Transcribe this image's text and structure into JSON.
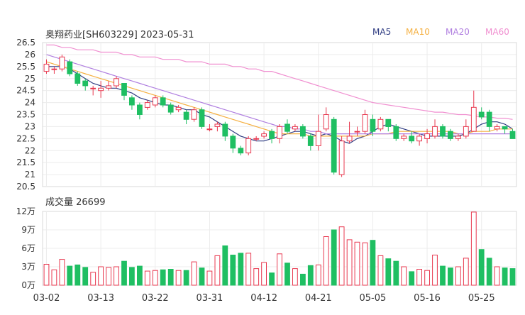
{
  "header": {
    "title": "奥翔药业[SH603229] 2023-05-31"
  },
  "legend": [
    {
      "label": "MA5",
      "color": "#2f3c82"
    },
    {
      "label": "MA10",
      "color": "#f5b041"
    },
    {
      "label": "MA20",
      "color": "#b07fe0"
    },
    {
      "label": "MA60",
      "color": "#f08fd0"
    }
  ],
  "volume_header": {
    "label": "成交量 26699"
  },
  "colors": {
    "up": "#e8384f",
    "down": "#1fbf62"
  },
  "chart_data": [
    {
      "type": "candlestick",
      "title": "奥翔药业[SH603229] 2023-05-31",
      "ylim": [
        20.5,
        26.5
      ],
      "y_ticks": [
        "26.5",
        "26",
        "25.5",
        "25",
        "24.5",
        "24",
        "23.5",
        "23",
        "22.5",
        "22",
        "21.5",
        "21",
        "20.5"
      ],
      "x_ticks": [
        "03-02",
        "03-13",
        "03-22",
        "03-31",
        "04-12",
        "04-21",
        "05-05",
        "05-16",
        "05-25"
      ],
      "x_tick_index": [
        0,
        7,
        14,
        21,
        28,
        35,
        42,
        49,
        56
      ],
      "candles": [
        [
          25.3,
          25.6,
          25.8,
          25.2
        ],
        [
          25.4,
          25.4,
          25.5,
          25.2
        ],
        [
          25.4,
          25.9,
          26.0,
          25.3
        ],
        [
          25.7,
          25.2,
          25.8,
          25.1
        ],
        [
          25.2,
          24.8,
          25.3,
          24.7
        ],
        [
          24.9,
          24.7,
          25.0,
          24.5
        ],
        [
          24.6,
          24.6,
          24.7,
          24.3
        ],
        [
          24.5,
          24.6,
          24.9,
          24.2
        ],
        [
          24.6,
          24.7,
          24.9,
          24.5
        ],
        [
          24.7,
          25.0,
          25.1,
          24.6
        ],
        [
          24.8,
          24.3,
          24.8,
          24.1
        ],
        [
          24.2,
          23.9,
          24.3,
          23.7
        ],
        [
          23.9,
          23.5,
          24.0,
          23.3
        ],
        [
          23.8,
          24.0,
          24.1,
          23.7
        ],
        [
          23.9,
          24.2,
          24.3,
          23.8
        ],
        [
          24.2,
          23.9,
          24.3,
          23.8
        ],
        [
          23.9,
          23.6,
          24.0,
          23.5
        ],
        [
          23.7,
          23.8,
          23.9,
          23.6
        ],
        [
          23.6,
          23.3,
          23.7,
          23.1
        ],
        [
          23.3,
          23.7,
          23.8,
          23.2
        ],
        [
          23.7,
          23.0,
          23.8,
          22.9
        ],
        [
          22.9,
          22.9,
          23.1,
          22.8
        ],
        [
          23.0,
          23.1,
          23.2,
          22.8
        ],
        [
          23.1,
          22.6,
          23.2,
          22.4
        ],
        [
          22.6,
          22.1,
          22.7,
          21.9
        ],
        [
          22.1,
          21.9,
          22.2,
          21.8
        ],
        [
          21.9,
          22.5,
          22.6,
          21.8
        ],
        [
          22.5,
          22.5,
          22.6,
          22.4
        ],
        [
          22.6,
          22.7,
          22.8,
          22.5
        ],
        [
          22.8,
          22.5,
          22.9,
          22.3
        ],
        [
          22.5,
          23.0,
          23.1,
          22.3
        ],
        [
          23.1,
          22.8,
          23.3,
          22.7
        ],
        [
          22.9,
          23.0,
          23.1,
          22.8
        ],
        [
          23.0,
          22.6,
          23.1,
          22.5
        ],
        [
          22.6,
          22.2,
          22.7,
          22.0
        ],
        [
          22.2,
          22.8,
          23.5,
          22.0
        ],
        [
          22.9,
          23.5,
          23.8,
          22.8
        ],
        [
          23.3,
          21.1,
          23.4,
          21.0
        ],
        [
          21.0,
          22.4,
          22.6,
          20.9
        ],
        [
          22.4,
          22.6,
          23.2,
          22.3
        ],
        [
          22.8,
          22.8,
          23.0,
          22.6
        ],
        [
          22.8,
          23.5,
          23.7,
          22.7
        ],
        [
          23.3,
          22.8,
          23.5,
          22.6
        ],
        [
          22.9,
          23.3,
          23.4,
          22.8
        ],
        [
          23.3,
          23.0,
          23.3,
          22.8
        ],
        [
          23.0,
          22.5,
          23.1,
          22.4
        ],
        [
          22.5,
          22.6,
          22.7,
          22.4
        ],
        [
          22.6,
          22.4,
          22.8,
          22.3
        ],
        [
          22.4,
          22.6,
          22.7,
          22.2
        ],
        [
          22.5,
          22.7,
          22.9,
          22.3
        ],
        [
          22.6,
          23.0,
          23.3,
          22.5
        ],
        [
          23.0,
          22.6,
          23.1,
          22.5
        ],
        [
          22.8,
          22.5,
          22.9,
          22.4
        ],
        [
          22.5,
          22.6,
          22.7,
          22.4
        ],
        [
          22.6,
          23.0,
          23.3,
          22.5
        ],
        [
          22.8,
          23.8,
          24.5,
          22.8
        ],
        [
          23.6,
          23.4,
          23.8,
          23.3
        ],
        [
          23.6,
          23.0,
          23.7,
          22.8
        ],
        [
          22.9,
          23.0,
          23.1,
          22.8
        ],
        [
          23.0,
          22.9,
          23.0,
          22.7
        ],
        [
          22.8,
          22.5,
          22.9,
          22.5
        ]
      ],
      "ma": {
        "MA5": [
          25.5,
          25.5,
          25.5,
          25.4,
          25.2,
          25.0,
          24.8,
          24.7,
          24.6,
          24.6,
          24.5,
          24.4,
          24.2,
          24.1,
          24.0,
          23.9,
          23.9,
          23.8,
          23.7,
          23.7,
          23.5,
          23.4,
          23.2,
          23.0,
          22.8,
          22.6,
          22.5,
          22.4,
          22.4,
          22.5,
          22.6,
          22.7,
          22.8,
          22.8,
          22.7,
          22.6,
          22.7,
          22.6,
          22.4,
          22.3,
          22.5,
          22.6,
          22.8,
          23.0,
          23.1,
          23.0,
          22.9,
          22.8,
          22.7,
          22.6,
          22.6,
          22.6,
          22.6,
          22.6,
          22.7,
          22.9,
          23.1,
          23.2,
          23.2,
          23.1,
          22.9
        ],
        "MA10": [
          25.7,
          25.6,
          25.5,
          25.4,
          25.3,
          25.2,
          25.1,
          25.0,
          24.9,
          24.8,
          24.7,
          24.6,
          24.5,
          24.4,
          24.3,
          24.2,
          24.1,
          24.0,
          23.9,
          23.8,
          23.7,
          23.6,
          23.5,
          23.4,
          23.3,
          23.2,
          23.1,
          23.0,
          22.9,
          22.8,
          22.7,
          22.7,
          22.7,
          22.7,
          22.6,
          22.6,
          22.6,
          22.6,
          22.6,
          22.6,
          22.6,
          22.6,
          22.7,
          22.7,
          22.7,
          22.8,
          22.8,
          22.8,
          22.8,
          22.8,
          22.8,
          22.8,
          22.8,
          22.7,
          22.7,
          22.8,
          22.8,
          22.8,
          22.9,
          22.9,
          22.9
        ],
        "MA20": [
          26.0,
          25.9,
          25.8,
          25.7,
          25.6,
          25.5,
          25.4,
          25.3,
          25.2,
          25.1,
          25.0,
          24.9,
          24.8,
          24.7,
          24.6,
          24.5,
          24.4,
          24.3,
          24.2,
          24.1,
          24.0,
          23.9,
          23.8,
          23.7,
          23.6,
          23.5,
          23.4,
          23.3,
          23.2,
          23.1,
          23.0,
          23.0,
          22.9,
          22.9,
          22.8,
          22.8,
          22.7,
          22.7,
          22.7,
          22.7,
          22.7,
          22.7,
          22.7,
          22.7,
          22.7,
          22.7,
          22.7,
          22.7,
          22.7,
          22.7,
          22.7,
          22.7,
          22.7,
          22.7,
          22.7,
          22.7,
          22.7,
          22.7,
          22.7,
          22.7,
          22.7
        ],
        "MA60": [
          26.4,
          26.4,
          26.3,
          26.3,
          26.2,
          26.2,
          26.2,
          26.1,
          26.1,
          26.1,
          26.0,
          26.0,
          25.9,
          25.9,
          25.9,
          25.8,
          25.8,
          25.8,
          25.7,
          25.7,
          25.7,
          25.6,
          25.6,
          25.6,
          25.5,
          25.5,
          25.4,
          25.4,
          25.3,
          25.3,
          25.2,
          25.1,
          25.0,
          24.9,
          24.8,
          24.7,
          24.6,
          24.5,
          24.4,
          24.3,
          24.2,
          24.1,
          24.0,
          23.95,
          23.9,
          23.85,
          23.8,
          23.75,
          23.7,
          23.65,
          23.6,
          23.6,
          23.55,
          23.5,
          23.5,
          23.45,
          23.4,
          23.4,
          23.35,
          23.35,
          23.3
        ]
      }
    },
    {
      "type": "bar",
      "title": "成交量 26699",
      "ylim": [
        0,
        120000
      ],
      "y_ticks": [
        "12万",
        "9万",
        "6万",
        "3万",
        "0万"
      ],
      "values": [
        34000,
        25000,
        42000,
        31000,
        33000,
        29000,
        21000,
        30000,
        29000,
        30000,
        39000,
        29000,
        31000,
        23000,
        24000,
        25000,
        26000,
        24000,
        24000,
        38000,
        28000,
        23000,
        48000,
        64000,
        49000,
        52000,
        52000,
        27000,
        37000,
        20000,
        51000,
        36000,
        27000,
        18000,
        32000,
        33000,
        79000,
        90000,
        95000,
        74000,
        70000,
        69000,
        73000,
        48000,
        43000,
        39000,
        30000,
        22000,
        26000,
        24000,
        49000,
        31000,
        28000,
        30000,
        44000,
        119000,
        58000,
        44000,
        30000,
        28000,
        27000
      ]
    }
  ]
}
